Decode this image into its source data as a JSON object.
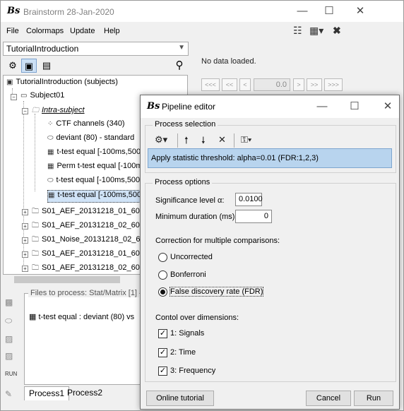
{
  "main_window": {
    "logo": "Bs",
    "title": "Brainstorm 28-Jan-2020",
    "controls": {
      "minimize": "—",
      "maximize": "☐",
      "close": "✕"
    }
  },
  "menu": [
    "File",
    "Colormaps",
    "Update",
    "Help"
  ],
  "protocol_dropdown": "TutorialIntroduction",
  "tree": {
    "root": "TutorialIntroduction (subjects)",
    "subject": "Subject01",
    "intra": "Intra-subject",
    "items": [
      "CTF channels (340)",
      "deviant (80) - standard",
      "t-test equal [-100ms,500",
      "Perm t-test equal [-100m",
      "t-test equal [-100ms,500",
      "t-test equal [-100ms,500"
    ],
    "runs": [
      "S01_AEF_20131218_01_60",
      "S01_AEF_20131218_02_60",
      "S01_Noise_20131218_02_60",
      "S01_AEF_20131218_01_60",
      "S01_AEF_20131218_02_60"
    ]
  },
  "right_panel": {
    "no_data": "No data loaded.",
    "nav_buttons": [
      "<<<",
      "<<",
      "<",
      ">",
      ">>",
      ">>>"
    ],
    "value": "0.0"
  },
  "process_panel": {
    "files_label": "Files to process: Stat/Matrix [1]",
    "file_item": "t-test equal : deviant (80) vs",
    "side_label": "RUN",
    "tabs": [
      "Process1",
      "Process2"
    ]
  },
  "dialog": {
    "logo": "Bs",
    "title": "Pipeline editor",
    "process_selection_label": "Process selection",
    "selected_process": "Apply statistic threshold: alpha=0.01 (FDR:1,2,3)",
    "process_options_label": "Process options",
    "significance_label": "Significance level α:",
    "significance_value": "0.0100",
    "min_duration_label": "Minimum duration (ms):",
    "min_duration_value": "0",
    "correction_label": "Correction for multiple comparisons:",
    "corrections": [
      {
        "label": "Uncorrected",
        "selected": false
      },
      {
        "label": "Bonferroni",
        "selected": false
      },
      {
        "label": "False discovery rate (FDR)",
        "selected": true
      }
    ],
    "control_label": "Contol over dimensions:",
    "dimensions": [
      {
        "label": "1: Signals",
        "checked": true
      },
      {
        "label": "2: Time",
        "checked": true
      },
      {
        "label": "3: Frequency",
        "checked": true
      }
    ],
    "buttons": {
      "tutorial": "Online tutorial",
      "cancel": "Cancel",
      "run": "Run"
    }
  }
}
